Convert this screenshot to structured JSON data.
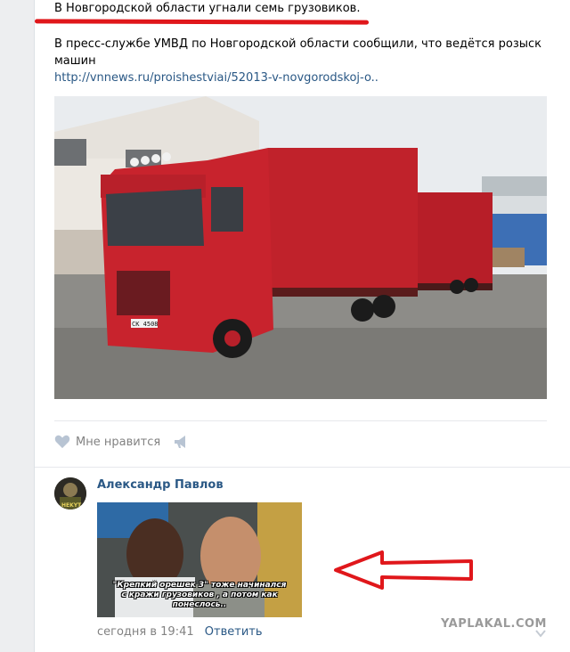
{
  "post": {
    "title": "В Новгородской области угнали семь грузовиков.",
    "body": "В пресс-службе УМВД по Новгородской области сообщили, что ведётся розыск машин",
    "link": "http://vnnews.ru/proishestviai/52013-v-novgorodskoj-o..",
    "photo_truck_plate": "СК 4508",
    "like_label": "Мне нравится",
    "colors": {
      "underline": "#e0171b",
      "link": "#2a5885",
      "truck": "#c0222b"
    }
  },
  "comment": {
    "author": "Александр Павлов",
    "meme_caption_line1": "\"Крепкий орешек 3\" тоже начинался",
    "meme_caption_line2": "с кражи грузовиков , а потом как понеслось..",
    "time": "сегодня в 19:41",
    "reply_label": "Ответить",
    "avatar_label": "HEKYT"
  },
  "watermark": "YAPLAKAL.COM"
}
